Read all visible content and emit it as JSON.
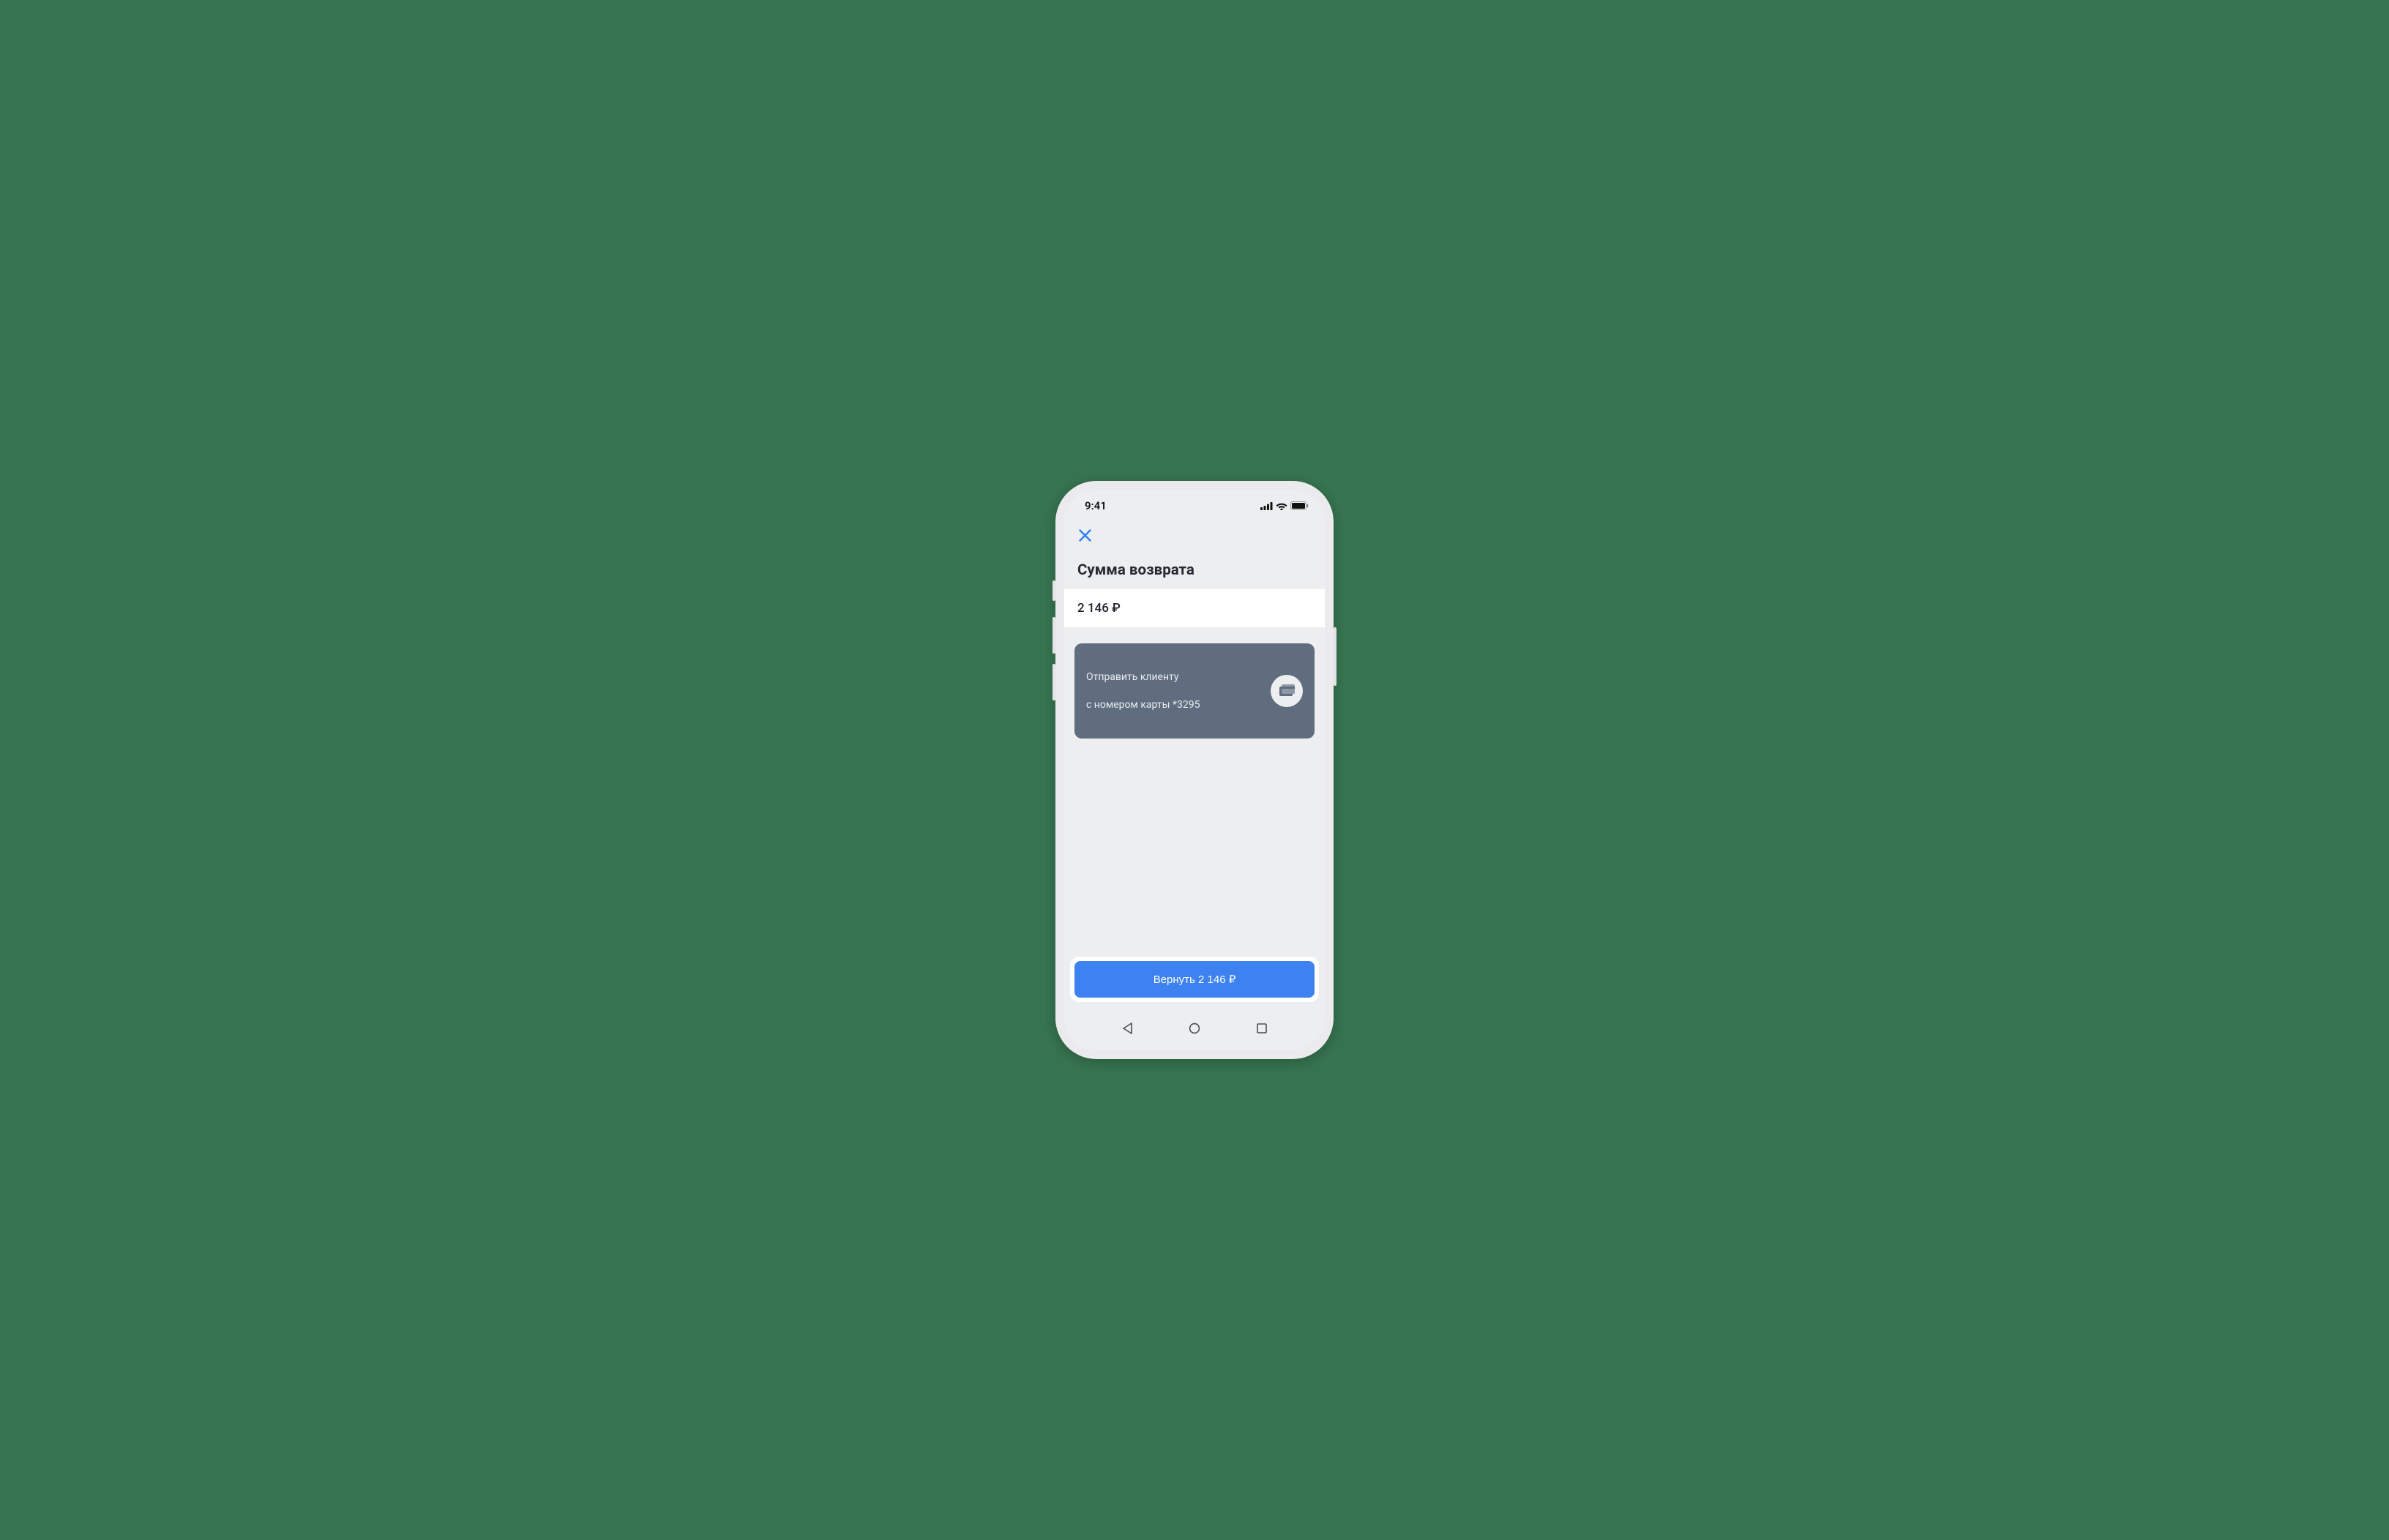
{
  "status": {
    "time": "9:41"
  },
  "title": "Сумма возврата",
  "amount": "2 146 ₽",
  "recipient": {
    "line1": "Отправить клиенту",
    "line2": "с номером карты *3295"
  },
  "primary_button": "Вернуть 2 146 ₽"
}
